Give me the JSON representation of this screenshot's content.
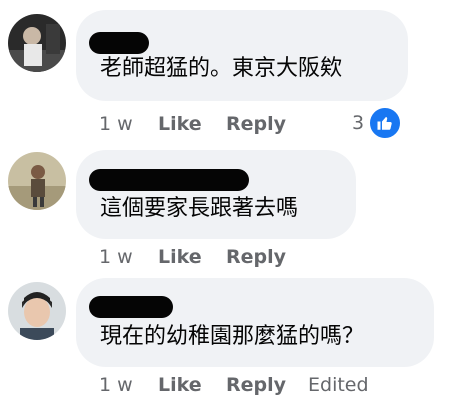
{
  "comments": [
    {
      "text": "老師超猛的。東京大阪欸",
      "time": "1 w",
      "like_label": "Like",
      "reply_label": "Reply",
      "reaction_count": "3"
    },
    {
      "text": "這個要家長跟著去嗎",
      "time": "1 w",
      "like_label": "Like",
      "reply_label": "Reply"
    },
    {
      "text": "現在的幼稚園那麼猛的嗎？",
      "time": "1 w",
      "like_label": "Like",
      "reply_label": "Reply",
      "edited_label": "Edited"
    }
  ],
  "colors": {
    "bubble": "#f0f2f5",
    "meta_text": "#65676b",
    "like_blue": "#1877f2"
  },
  "icons": [
    "thumbs-up-icon"
  ]
}
